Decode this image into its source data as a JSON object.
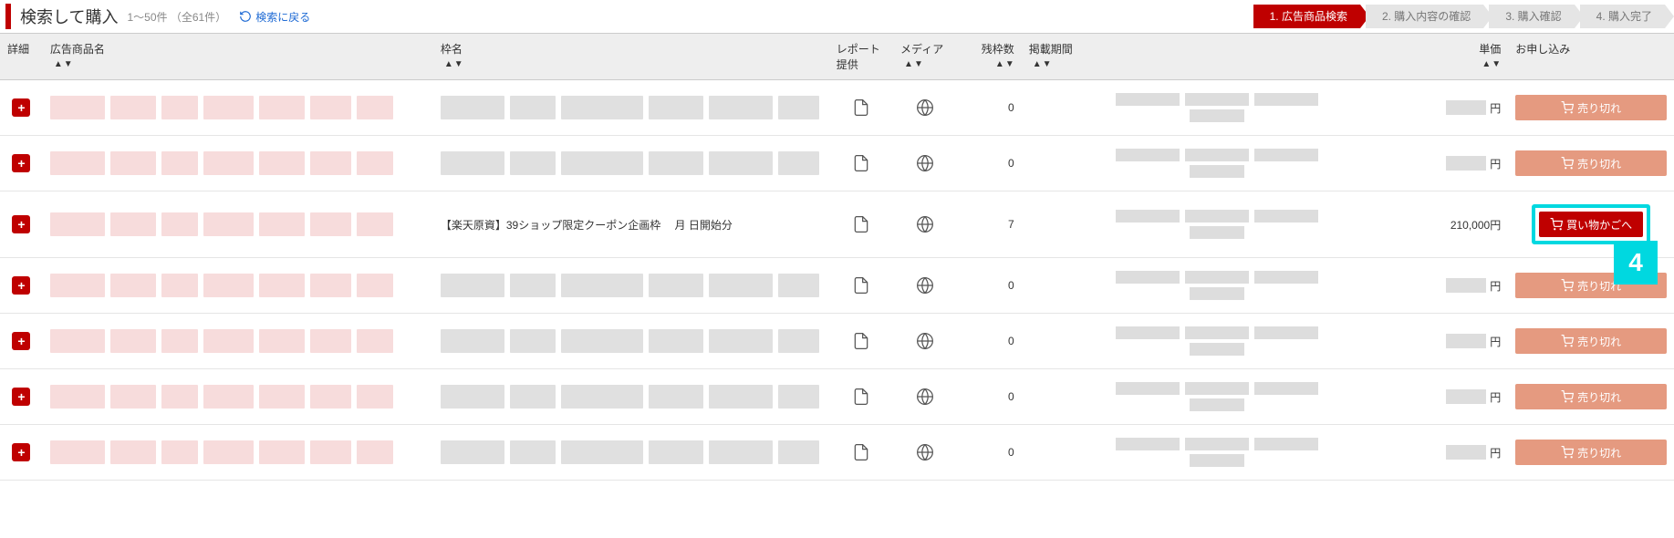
{
  "header": {
    "title": "検索して購入",
    "count": "1～50件 （全61件）",
    "back_label": "検索に戻る"
  },
  "steps": [
    {
      "label": "1. 広告商品検索",
      "active": true
    },
    {
      "label": "2. 購入内容の確認",
      "active": false
    },
    {
      "label": "3. 購入確認",
      "active": false
    },
    {
      "label": "4. 購入完了",
      "active": false
    }
  ],
  "columns": {
    "expand": "詳細",
    "name": "広告商品名",
    "slot": "枠名",
    "report": "レポート提供",
    "media": "メディア",
    "remain": "残枠数",
    "period": "掲載期間",
    "price": "単価",
    "apply": "お申し込み"
  },
  "labels": {
    "yen_suffix": "円",
    "sold_out": "売り切れ",
    "add_cart": "買い物かごへ"
  },
  "rows": [
    {
      "blurred": true,
      "slot_text": "",
      "remain": "0",
      "price": "",
      "status": "sold"
    },
    {
      "blurred": true,
      "slot_text": "",
      "remain": "0",
      "price": "",
      "status": "sold"
    },
    {
      "blurred": true,
      "slot_text": "【楽天原資】39ショップ限定クーポン企画枠　 月  日開始分",
      "remain": "7",
      "price": "210,000",
      "status": "cart"
    },
    {
      "blurred": true,
      "slot_text": "",
      "remain": "0",
      "price": "",
      "status": "sold"
    },
    {
      "blurred": true,
      "slot_text": "",
      "remain": "0",
      "price": "",
      "status": "sold"
    },
    {
      "blurred": true,
      "slot_text": "",
      "remain": "0",
      "price": "",
      "status": "sold"
    },
    {
      "blurred": true,
      "slot_text": "",
      "remain": "0",
      "price": "",
      "status": "sold"
    }
  ],
  "annotation": {
    "badge": "4"
  }
}
